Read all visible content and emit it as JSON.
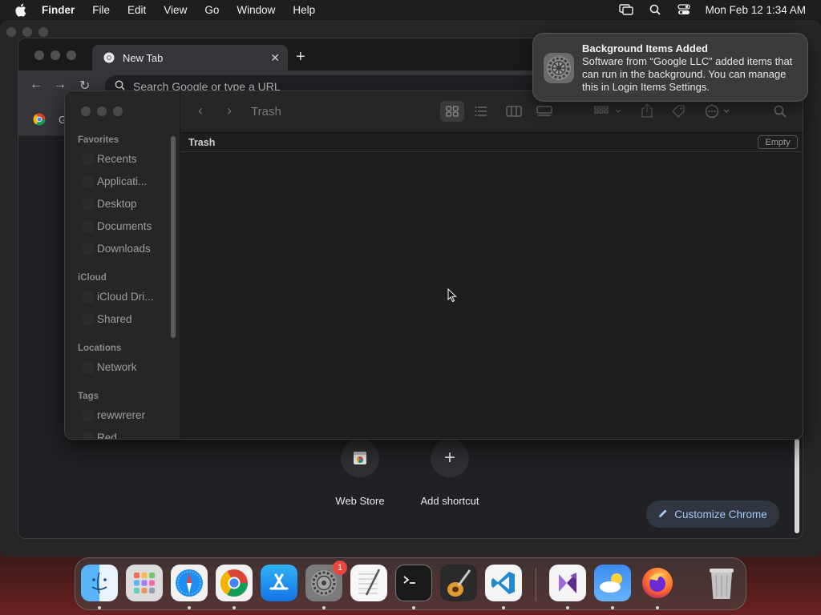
{
  "menubar": {
    "app_name": "Finder",
    "menus": [
      "File",
      "Edit",
      "View",
      "Go",
      "Window",
      "Help"
    ],
    "clock": "Mon Feb 12  1:34 AM"
  },
  "chrome": {
    "tab_title": "New Tab",
    "omnibox_placeholder": "Search Google or type a URL",
    "bookmark_initial": "G",
    "shortcuts": [
      {
        "label": "Web Store"
      },
      {
        "label": "Add shortcut",
        "glyph": "+"
      }
    ],
    "customize_label": "Customize Chrome"
  },
  "finder": {
    "window_title": "Trash",
    "path_label": "Trash",
    "empty_button": "Empty",
    "sidebar": {
      "favorites_header": "Favorites",
      "favorites": [
        "Recents",
        "Applicati...",
        "Desktop",
        "Documents",
        "Downloads"
      ],
      "icloud_header": "iCloud",
      "icloud": [
        "iCloud Dri...",
        "Shared"
      ],
      "locations_header": "Locations",
      "locations": [
        "Network"
      ],
      "tags_header": "Tags",
      "tags": [
        "rewwrerer",
        "Red"
      ]
    }
  },
  "notification": {
    "title": "Background Items Added",
    "body": "Software from “Google LLC” added items that can run in the background. You can manage this in Login Items Settings."
  },
  "dock": {
    "apps": [
      "finder",
      "launchpad",
      "safari",
      "chrome",
      "app-store",
      "system-settings",
      "textedit",
      "terminal",
      "garageband",
      "vscode",
      "visual-studio",
      "weather",
      "firefox",
      "trash"
    ],
    "system_settings_badge": "1"
  },
  "colors": {
    "accent_blue": "#a8c7fa",
    "badge_red": "#e8453c"
  }
}
